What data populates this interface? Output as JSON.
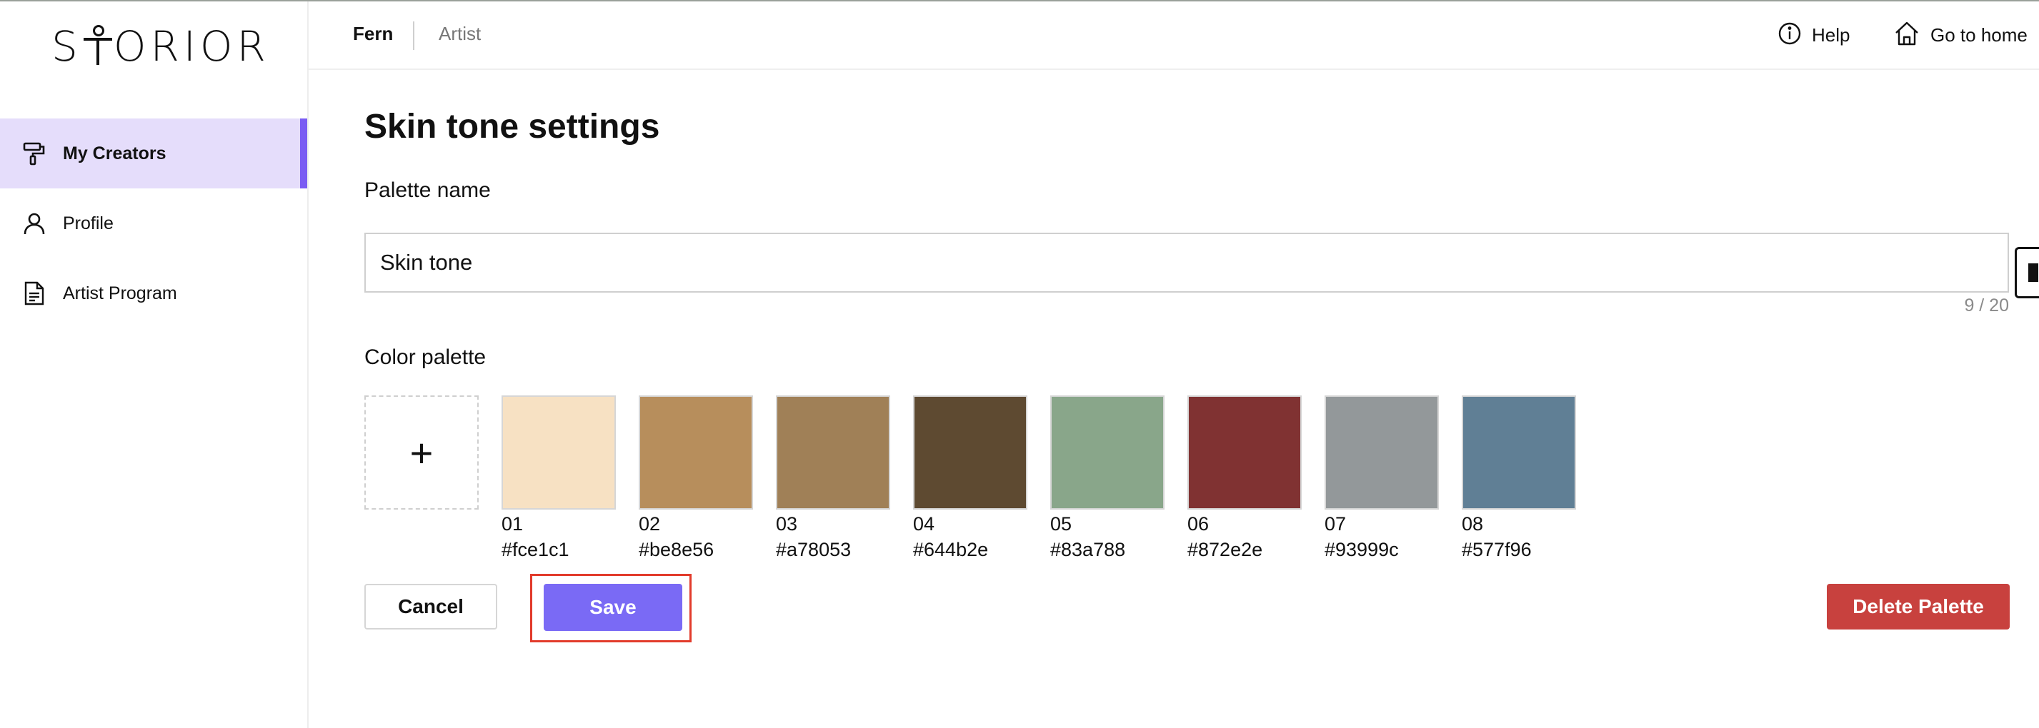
{
  "app": {
    "logo_text": "STORIOR"
  },
  "sidebar": {
    "items": [
      {
        "label": "My Creators",
        "icon": "paint-roller-icon",
        "active": true
      },
      {
        "label": "Profile",
        "icon": "user-icon",
        "active": false
      },
      {
        "label": "Artist Program",
        "icon": "document-icon",
        "active": false
      }
    ],
    "accent_color": "#7a5cf3",
    "active_bg": "#e5ddfb"
  },
  "header": {
    "breadcrumb": {
      "primary": "Fern",
      "secondary": "Artist"
    },
    "help_label": "Help",
    "home_label": "Go to home"
  },
  "main": {
    "title": "Skin tone settings",
    "palette_name_label": "Palette name",
    "palette_name_value": "Skin tone",
    "char_counter": "9 / 20",
    "color_palette_label": "Color palette",
    "add_color_symbol": "+",
    "colors": [
      {
        "number": "01",
        "hex": "#fce1c1",
        "fill": "#f7e1c3"
      },
      {
        "number": "02",
        "hex": "#be8e56",
        "fill": "#b78e5c"
      },
      {
        "number": "03",
        "hex": "#a78053",
        "fill": "#a08057"
      },
      {
        "number": "04",
        "hex": "#644b2e",
        "fill": "#5e4a31"
      },
      {
        "number": "05",
        "hex": "#83a788",
        "fill": "#89a68a"
      },
      {
        "number": "06",
        "hex": "#872e2e",
        "fill": "#803232"
      },
      {
        "number": "07",
        "hex": "#93999c",
        "fill": "#93989a"
      },
      {
        "number": "08",
        "hex": "#577f96",
        "fill": "#607f95"
      }
    ],
    "buttons": {
      "cancel": "Cancel",
      "save": "Save",
      "delete": "Delete Palette"
    }
  },
  "colors": {
    "save_bg": "#7a6af5",
    "delete_bg": "#c8413e",
    "highlight_outline": "#e23b2b"
  }
}
